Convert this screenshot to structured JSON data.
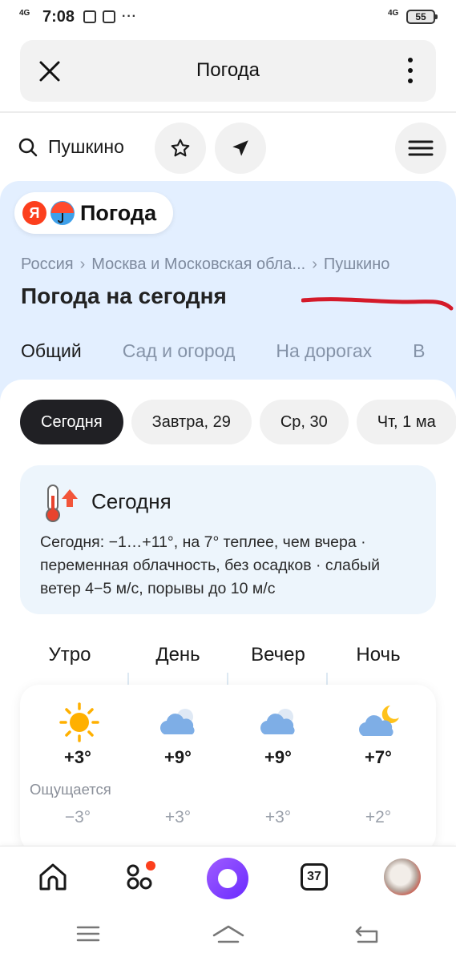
{
  "status_bar": {
    "network": "4G",
    "time": "7:08",
    "dots": "···",
    "network_right": "4G",
    "battery": "55"
  },
  "browser": {
    "title": "Погода"
  },
  "search": {
    "city": "Пушкино"
  },
  "logo": {
    "ya": "Я",
    "text": "Погода"
  },
  "breadcrumb": [
    "Россия",
    "Москва и Московская обла...",
    "Пушкино"
  ],
  "breadcrumb_separator": "›",
  "page_title": "Погода на сегодня",
  "tabs": [
    "Общий",
    "Сад и огород",
    "На дорогах",
    "В"
  ],
  "days": [
    "Сегодня",
    "Завтра, 29",
    "Ср, 30",
    "Чт, 1 ма"
  ],
  "summary": {
    "title": "Сегодня",
    "text": "Сегодня: −1…+11°, на 7° теплее, чем вчера · переменная облачность, без осадков · слабый ветер 4−5 м/с, порывы до 10 м/с"
  },
  "day_parts": {
    "feels_label": "Ощущается",
    "items": [
      {
        "name": "Утро",
        "icon": "sun-icon",
        "temp": "+3°",
        "feels": "−3°"
      },
      {
        "name": "День",
        "icon": "cloud-icon",
        "temp": "+9°",
        "feels": "+3°"
      },
      {
        "name": "Вечер",
        "icon": "cloud-icon",
        "temp": "+9°",
        "feels": "+3°"
      },
      {
        "name": "Ночь",
        "icon": "moon-cloud-icon",
        "temp": "+7°",
        "feels": "+2°"
      }
    ]
  },
  "bottom_nav": {
    "tabs_count": "37"
  },
  "colors": {
    "hero_bg": "#e3efff",
    "active_day": "#202024",
    "accent_red": "#fc3f1d",
    "alice": "#7b3cff"
  }
}
